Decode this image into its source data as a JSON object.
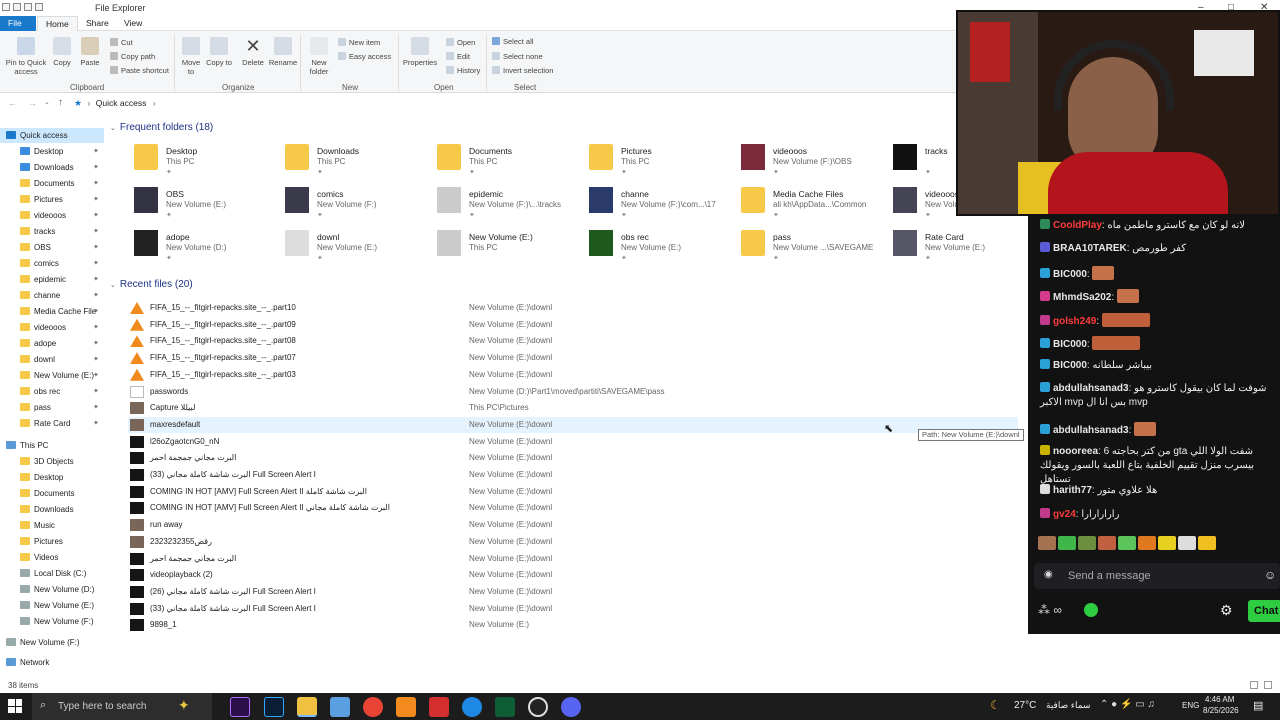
{
  "window": {
    "title": "File Explorer",
    "status_items": "38 items"
  },
  "tabs": [
    "File",
    "Home",
    "Share",
    "View"
  ],
  "ribbon": {
    "pin": "Pin to Quick access",
    "copy": "Copy",
    "paste": "Paste",
    "cut": "Cut",
    "copy_path": "Copy path",
    "paste_shortcut": "Paste shortcut",
    "clipboard": "Clipboard",
    "move_to": "Move to",
    "copy_to": "Copy to",
    "delete": "Delete",
    "rename": "Rename",
    "organize": "Organize",
    "new_folder": "New folder",
    "new_item": "New item",
    "easy_access": "Easy access",
    "new": "New",
    "properties": "Properties",
    "open": "Open",
    "edit": "Edit",
    "history": "History",
    "open_group": "Open",
    "select_all": "Select all",
    "select_none": "Select none",
    "invert_selection": "Invert selection",
    "select": "Select"
  },
  "address": {
    "root": "Quick access"
  },
  "nav": {
    "quick_access": "Quick access",
    "pinned": [
      "Desktop",
      "Downloads",
      "Documents",
      "Pictures",
      "videooos",
      "tracks",
      "OBS",
      "comics",
      "epidemic",
      "channe",
      "Media Cache File",
      "videooos",
      "adope",
      "downl",
      "New Volume (E:)",
      "obs rec",
      "pass",
      "Rate Card"
    ],
    "this_pc": "This PC",
    "pc_items": [
      "3D Objects",
      "Desktop",
      "Documents",
      "Downloads",
      "Music",
      "Pictures",
      "Videos",
      "Local Disk (C:)",
      "New Volume (D:)",
      "New Volume (E:)",
      "New Volume (F:)"
    ],
    "new_volume_f": "New Volume (F:)",
    "network": "Network"
  },
  "frequent": {
    "header": "Frequent folders (18)",
    "items": [
      {
        "name": "Desktop",
        "path": "This PC"
      },
      {
        "name": "Downloads",
        "path": "This PC"
      },
      {
        "name": "Documents",
        "path": "This PC"
      },
      {
        "name": "Pictures",
        "path": "This PC"
      },
      {
        "name": "videooos",
        "path": "New Volume (F:)\\OBS"
      },
      {
        "name": "tracks",
        "path": ""
      },
      {
        "name": "OBS",
        "path": "New Volume (E:)"
      },
      {
        "name": "comics",
        "path": "New Volume (F:)"
      },
      {
        "name": "epidemic",
        "path": "New Volume (F:)\\...\\tracks"
      },
      {
        "name": "channe",
        "path": "New Volume (F:)\\com...\\17"
      },
      {
        "name": "Media Cache Files",
        "path": "ali kh\\AppData...\\Common"
      },
      {
        "name": "videooos",
        "path": "New Volume"
      },
      {
        "name": "adope",
        "path": "New Volume (D:)"
      },
      {
        "name": "downl",
        "path": "New Volume (E:)"
      },
      {
        "name": "New Volume (E:)",
        "path": "This PC"
      },
      {
        "name": "obs rec",
        "path": "New Volume (E:)"
      },
      {
        "name": "pass",
        "path": "New Volume ...\\SAVEGAME"
      },
      {
        "name": "Rate Card",
        "path": "New Volume (E:)"
      }
    ]
  },
  "recent": {
    "header": "Recent files (20)",
    "items": [
      {
        "name": "FIFA_15_--_fitgirl-repacks.site_--_.part10",
        "path": "New Volume (E:)\\downl"
      },
      {
        "name": "FIFA_15_--_fitgirl-repacks.site_--_.part09",
        "path": "New Volume (E:)\\downl"
      },
      {
        "name": "FIFA_15_--_fitgirl-repacks.site_--_.part08",
        "path": "New Volume (E:)\\downl"
      },
      {
        "name": "FIFA_15_--_fitgirl-repacks.site_--_.part07",
        "path": "New Volume (E:)\\downl"
      },
      {
        "name": "FIFA_15_--_fitgirl-repacks.site_--_.part03",
        "path": "New Volume (E:)\\downl"
      },
      {
        "name": "passwords",
        "path": "New Volume (D:)\\Part1\\moved\\partiti\\SAVEGAME\\pass"
      },
      {
        "name": "Capture لبيللا",
        "path": "This PC\\Pictures"
      },
      {
        "name": "maxresdefault",
        "path": "New Volume (E:)\\downl"
      },
      {
        "name": "l26oZgaotcnG0_nN",
        "path": "New Volume (E:)\\downl"
      },
      {
        "name": "البرت مجاني جمجمة احمر",
        "path": "New Volume (E:)\\downl"
      },
      {
        "name": "البرت شاشة كاملة مجاني (33) Full Screen Alert I",
        "path": "New Volume (E:)\\downl"
      },
      {
        "name": "COMING IN HOT [AMV] Full Screen Alert II البرت شاشة كاملة",
        "path": "New Volume (E:)\\downl"
      },
      {
        "name": "COMING IN HOT [AMV] Full Screen Alert II البرت شاشة كاملة مجاني",
        "path": "New Volume (E:)\\downl"
      },
      {
        "name": "run away",
        "path": "New Volume (E:)\\downl"
      },
      {
        "name": "2323232355رقص",
        "path": "New Volume (E:)\\downl"
      },
      {
        "name": "البرت مجاني جمجمة احمر",
        "path": "New Volume (E:)\\downl"
      },
      {
        "name": "videoplayback (2)",
        "path": "New Volume (E:)\\downl"
      },
      {
        "name": "البرت شاشة كاملة مجاني (26) Full Screen Alert I",
        "path": "New Volume (E:)\\downl"
      },
      {
        "name": "البرت شاشة كاملة مجاني (33) Full Screen Alert I",
        "path": "New Volume (E:)\\downl"
      },
      {
        "name": "9898_1",
        "path": "New Volume (E:)"
      }
    ]
  },
  "tooltip": "Path: New Volume (E:)\\downl",
  "taskbar": {
    "search": "Type here to search",
    "weather": "27°C",
    "weather_text": "سماء صافية",
    "lang": "ENG",
    "time": "4:46 AM",
    "date": "8/25/2026"
  },
  "chat": {
    "messages": [
      {
        "user": "CooldPlay",
        "text": "لانه لو كان مع كاسترو ماطمن ماه",
        "color": "#ff3c3c"
      },
      {
        "user": "BRAA10TAREK",
        "text": "كفر طورمص",
        "color": "#e6e6e6"
      },
      {
        "user": "BIC000",
        "text": "",
        "color": "#e6e6e6"
      },
      {
        "user": "MhmdSa202",
        "text": "",
        "color": "#e6e6e6"
      },
      {
        "user": "golsh249",
        "text": "",
        "color": "#ff3c3c"
      },
      {
        "user": "BIC000",
        "text": "",
        "color": "#e6e6e6"
      },
      {
        "user": "BIC000",
        "text": "بيباشر سلطانه",
        "color": "#e6e6e6"
      },
      {
        "user": "abdullahsanad3",
        "text": "شوفت لما كان بيقول كاسترو هو الاكبر mvp بس انا ال mvp",
        "color": "#e6e6e6"
      },
      {
        "user": "abdullahsanad3",
        "text": "",
        "color": "#e6e6e6"
      },
      {
        "user": "noooreea",
        "text": "من كتر بحاجته 6 gta شفت الولا اللي بيسرب منزل تقييم الخلفية بتاع اللعبة بالسور ويقولك تستاهل",
        "color": "#e6e6e6"
      },
      {
        "user": "harith77",
        "text": "هلا علاوي متور",
        "color": "#e6e6e6"
      },
      {
        "user": "gv24",
        "text": "رارارارارا",
        "color": "#ff3c3c"
      }
    ],
    "input_placeholder": "Send a message",
    "chat_button": "Chat"
  },
  "colors": {
    "accent": "#1979ca",
    "chat_bg": "#121212",
    "chat_btn": "#2ecc40"
  }
}
